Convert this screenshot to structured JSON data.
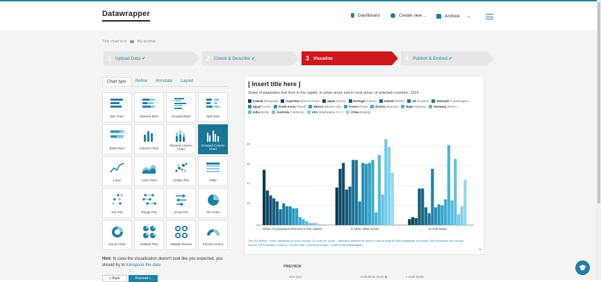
{
  "header": {
    "logo": "Datawrapper",
    "nav": {
      "dashboard": "Dashboard",
      "create": "Create new ...",
      "archive": "Archive"
    }
  },
  "breadcrumb": {
    "prefix": "This chart is in",
    "folder": "My archive"
  },
  "steps": [
    {
      "num": "1",
      "label": "Upload Data",
      "state": "done"
    },
    {
      "num": "2",
      "label": "Check & Describe",
      "state": "done"
    },
    {
      "num": "3",
      "label": "Visualize",
      "state": "active"
    },
    {
      "num": "4",
      "label": "Publish & Embed",
      "state": "done"
    }
  ],
  "tabs": [
    "Chart type",
    "Refine",
    "Annotate",
    "Layout"
  ],
  "chart_types": [
    {
      "label": "Bar Chart",
      "icon": "bar-chart-icon"
    },
    {
      "label": "Stacked Bars",
      "icon": "stacked-bars-icon"
    },
    {
      "label": "Grouped Bars",
      "icon": "grouped-bars-icon"
    },
    {
      "label": "Split Bars",
      "icon": "split-bars-icon"
    },
    {
      "label": "Bullet Bars",
      "icon": "bullet-bars-icon"
    },
    {
      "label": "Column Chart",
      "icon": "column-chart-icon"
    },
    {
      "label": "Stacked Column Chart",
      "icon": "stacked-column-icon"
    },
    {
      "label": "Grouped Column Chart",
      "icon": "grouped-column-icon",
      "selected": true
    },
    {
      "label": "Lines",
      "icon": "lines-icon"
    },
    {
      "label": "Area Chart",
      "icon": "area-chart-icon"
    },
    {
      "label": "Scatter Plot",
      "icon": "scatter-plot-icon"
    },
    {
      "label": "Table",
      "icon": "table-icon"
    },
    {
      "label": "Dot Plot",
      "icon": "dot-plot-icon"
    },
    {
      "label": "Range Plot",
      "icon": "range-plot-icon"
    },
    {
      "label": "Arrow Plot",
      "icon": "arrow-plot-icon"
    },
    {
      "label": "Pie Chart",
      "icon": "pie-chart-icon"
    },
    {
      "label": "Donut Chart",
      "icon": "donut-chart-icon"
    },
    {
      "label": "Multiple Pies",
      "icon": "multiple-pies-icon"
    },
    {
      "label": "Multiple Donuts",
      "icon": "multiple-donuts-icon"
    },
    {
      "label": "Election Donut",
      "icon": "election-donut-icon"
    }
  ],
  "hint": {
    "bold": "Hint:",
    "text": "In case the visualization doesn't look like you expected, you should try to",
    "link": "transpose the data"
  },
  "buttons": {
    "back": "« Back",
    "proceed": "Proceed »"
  },
  "preview": {
    "title": "[ Insert title here ]",
    "subtitle": "Share of population that lives in the capital, in urban areas and in rural areas, of selected countries, 2014.",
    "notes": "The UN defines \"urban\" differently for each country. To count as \"urban\", Japanese settlements need to have at least 50,000 inhabitants, in Iceland, 200 inhabitants are enough.",
    "source_prefix": "Source: UN Population Division • Get the data • Download image • Created with",
    "source_link": "Datawrapper"
  },
  "preview_panel": {
    "header": "PREVIEW",
    "size_label": "Size (px)",
    "colorblind_label": "Colorblind check",
    "dark_label": "Dark Mode"
  },
  "colors": {
    "accent": "#1d81a2",
    "active_step": "#d0171b"
  },
  "chart_data": {
    "type": "bar",
    "categories": [
      "Share of population that lives in the capital",
      "in other urban areas",
      "in rural areas"
    ],
    "ylim": [
      0,
      100
    ],
    "yticks": [
      20,
      40,
      60,
      80
    ],
    "grid": true,
    "legend_position": "top",
    "series": [
      {
        "name": "Iceland",
        "city": "(Reykjavik)",
        "color": "#0b3a52",
        "values": [
          56,
          38,
          6
        ]
      },
      {
        "name": "Argentina",
        "city": "(Buenos Aires)",
        "color": "#0e4560",
        "values": [
          35,
          57,
          8
        ]
      },
      {
        "name": "Japan",
        "city": "(Tokyo)",
        "color": "#124f6c",
        "values": [
          30,
          63,
          7
        ]
      },
      {
        "name": "Portugal",
        "city": "(Lisbon)",
        "color": "#155a78",
        "values": [
          27,
          36,
          37
        ]
      },
      {
        "name": "Ireland",
        "city": "(Dublin)",
        "color": "#186484",
        "values": [
          24,
          39,
          37
        ]
      },
      {
        "name": "UK",
        "city": "(London)",
        "color": "#1b6e90",
        "values": [
          16,
          66,
          18
        ]
      },
      {
        "name": "Denmark",
        "city": "(Copenhagen)",
        "color": "#1e789c",
        "values": [
          22,
          66,
          12
        ]
      },
      {
        "name": "Egypt",
        "city": "(Cairo)",
        "color": "#2283a8",
        "values": [
          19,
          24,
          57
        ]
      },
      {
        "name": "South Korea",
        "city": "(Seoul)",
        "color": "#268db3",
        "values": [
          19,
          63,
          18
        ]
      },
      {
        "name": "Mexico",
        "city": "(Mexico City)",
        "color": "#2a97bd",
        "values": [
          17,
          62,
          21
        ]
      },
      {
        "name": "France",
        "city": "(Paris)",
        "color": "#32a1c6",
        "values": [
          17,
          63,
          20
        ]
      },
      {
        "name": "Russia",
        "city": "(Moscow)",
        "color": "#3cabcf",
        "values": [
          8,
          66,
          26
        ]
      },
      {
        "name": "Niger",
        "city": "(Niamey)",
        "color": "#47b3d6",
        "values": [
          6,
          13,
          81
        ]
      },
      {
        "name": "Germany",
        "city": "(Berlin)",
        "color": "#54bbdc",
        "values": [
          4,
          71,
          25
        ]
      },
      {
        "name": "India",
        "city": "(Delhi)",
        "color": "#61c3e2",
        "values": [
          2,
          31,
          67
        ]
      },
      {
        "name": "Australia",
        "city": "(Canberra)",
        "color": "#70cae7",
        "values": [
          2,
          87,
          11
        ]
      },
      {
        "name": "USA",
        "city": "(Washington, D.C.)",
        "color": "#80d1eb",
        "values": [
          2,
          79,
          19
        ]
      },
      {
        "name": "China",
        "city": "(Beijing)",
        "color": "#92d8ef",
        "values": [
          1,
          53,
          46
        ]
      }
    ]
  }
}
